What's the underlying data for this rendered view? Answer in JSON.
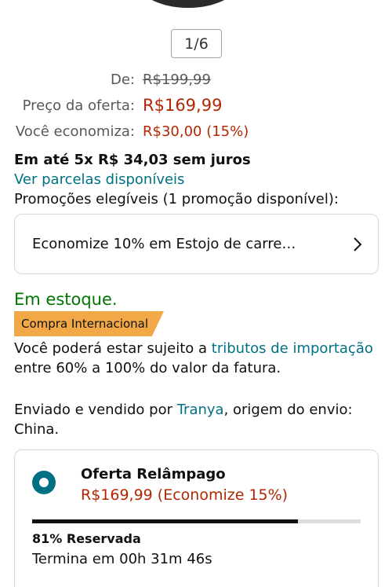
{
  "pager": {
    "text": "1/6"
  },
  "pricing": {
    "list_label": "De:",
    "list_price": "R$199,99",
    "offer_label": "Preço da oferta:",
    "offer_price": "R$169,99",
    "savings_label": "Você economiza:",
    "savings_value": "R$30,00 (15%)"
  },
  "installments": {
    "text": "Em até 5x R$ 34,03 sem juros",
    "link": "Ver parcelas disponíveis"
  },
  "promotions": {
    "heading": "Promoções elegíveis   (1 promoção disponível):",
    "item": "Economize 10% em Estojo de carre…"
  },
  "availability": {
    "stock": "Em estoque.",
    "badge": "Compra Internacional",
    "tax_pre": "Você poderá estar sujeito a ",
    "tax_link": "tributos de importação",
    "tax_post": " entre 60% a 100% do valor da fatura."
  },
  "seller": {
    "pre": "Enviado e vendido por ",
    "name": "Tranya",
    "post": ", origem do envio: China."
  },
  "deal": {
    "title": "Oferta Relâmpago",
    "price": "R$169,99 (Economize 15%)",
    "reserved_fraction": 0.81,
    "reserved_text": "81% Reservada",
    "ends_text": "Termina em 00h 31m 46s"
  }
}
